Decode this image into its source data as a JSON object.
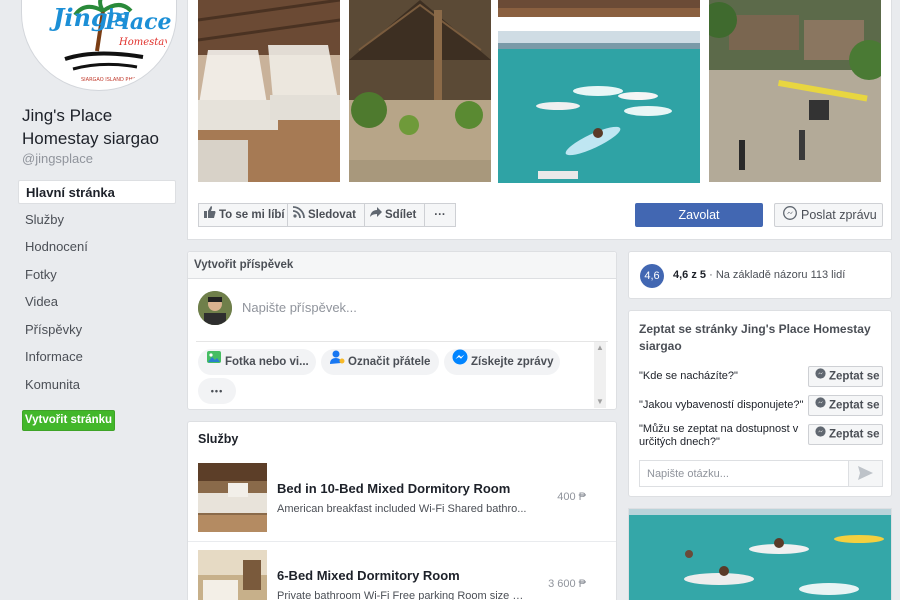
{
  "page": {
    "name": "Jing's Place Homestay siargao",
    "handle": "@jingsplace",
    "logo_text": {
      "line1": "Jing's",
      "line2": "Place",
      "line3": "Homestay",
      "tag": "SIARGAO ISLAND PHILIP..."
    }
  },
  "nav": {
    "items": [
      {
        "label": "Hlavní stránka",
        "active": true
      },
      {
        "label": "Služby"
      },
      {
        "label": "Hodnocení"
      },
      {
        "label": "Fotky"
      },
      {
        "label": "Videa"
      },
      {
        "label": "Příspěvky"
      },
      {
        "label": "Informace"
      },
      {
        "label": "Komunita"
      }
    ],
    "create_page": "Vytvořit stránku"
  },
  "actions": {
    "like": "To se mi líbí",
    "follow": "Sledovat",
    "share": "Sdílet",
    "more": "···",
    "call": "Zavolat",
    "message": "Poslat zprávu"
  },
  "composer": {
    "title": "Vytvořit příspěvek",
    "placeholder": "Napište příspěvek...",
    "chips": {
      "photo": "Fotka nebo vi...",
      "tag": "Označit přátele",
      "messages": "Získejte zprávy",
      "more": "•••"
    }
  },
  "services": {
    "title": "Služby",
    "items": [
      {
        "name": "Bed in 10-Bed Mixed Dormitory Room",
        "desc": "American breakfast included Wi-Fi Shared bathro...",
        "price": "400 ₱"
      },
      {
        "name": "6-Bed Mixed Dormitory Room",
        "desc": "Private bathroom Wi-Fi Free parking Room size 2...",
        "price": "3 600 ₱"
      }
    ]
  },
  "rating": {
    "badge": "4,6",
    "score": "4,6 z 5",
    "basis": "· Na základě názoru 113 lidí"
  },
  "ask": {
    "title": "Zeptat se stránky Jing's Place Homestay siargao",
    "button": "Zeptat se",
    "questions": [
      "\"Kde se nacházíte?\"",
      "\"Jakou vybaveností disponujete?\"",
      "\"Můžu se zeptat na dostupnost v určitých dnech?\""
    ],
    "placeholder": "Napište otázku..."
  },
  "colors": {
    "brand_blue": "#4267b2",
    "green": "#42b72a",
    "background": "#e9ebee"
  }
}
